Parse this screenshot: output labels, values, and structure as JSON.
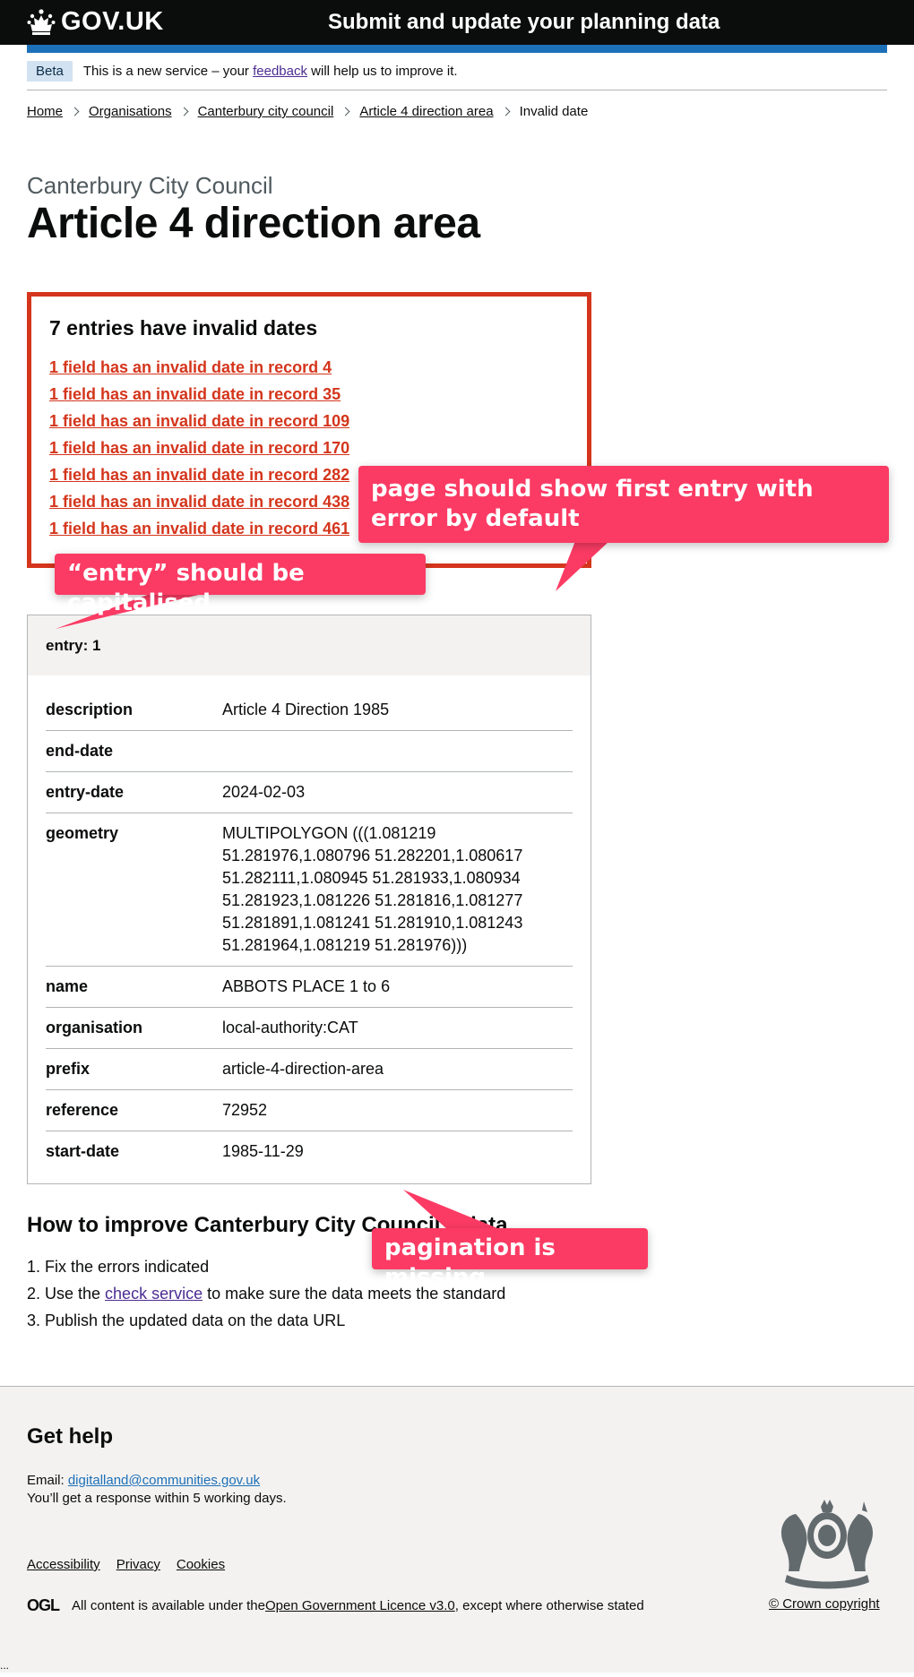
{
  "header": {
    "logo_text": "GOV.UK",
    "service_name": "Submit and update your planning data"
  },
  "phase_banner": {
    "tag": "Beta",
    "text_before": "This is a new service – your ",
    "link": "feedback",
    "text_after": " will help us to improve it."
  },
  "breadcrumbs": [
    "Home",
    "Organisations",
    "Canterbury city council",
    "Article 4 direction area",
    "Invalid date"
  ],
  "caption": "Canterbury City Council",
  "title": "Article 4 direction area",
  "error_summary": {
    "title": "7 entries have invalid dates",
    "items": [
      "1 field has an invalid date in record 4",
      "1 field has an invalid date in record 35",
      "1 field has an invalid date in record 109",
      "1 field has an invalid date in record 170",
      "1 field has an invalid date in record 282",
      "1 field has an invalid date in record 438",
      "1 field has an invalid date in record 461"
    ]
  },
  "entry_card": {
    "title": "entry: 1",
    "rows": [
      {
        "key": "description",
        "value": "Article 4 Direction 1985"
      },
      {
        "key": "end-date",
        "value": ""
      },
      {
        "key": "entry-date",
        "value": "2024-02-03"
      },
      {
        "key": "geometry",
        "value": "MULTIPOLYGON (((1.081219 51.281976,1.080796 51.282201,1.080617 51.282111,1.080945 51.281933,1.080934 51.281923,1.081226 51.281816,1.081277 51.281891,1.081241 51.281910,1.081243 51.281964,1.081219 51.281976)))"
      },
      {
        "key": "name",
        "value": "ABBOTS PLACE 1 to 6"
      },
      {
        "key": "organisation",
        "value": "local-authority:CAT"
      },
      {
        "key": "prefix",
        "value": "article-4-direction-area"
      },
      {
        "key": "reference",
        "value": "72952"
      },
      {
        "key": "start-date",
        "value": "1985-11-29"
      }
    ]
  },
  "improve": {
    "heading": "How to improve Canterbury City Council’s data",
    "step1": "1. Fix the errors indicated",
    "step2_before": "2. Use the ",
    "step2_link": "check service",
    "step2_after": " to make sure the data meets the standard",
    "step3": "3. Publish the updated data on the data URL"
  },
  "footer": {
    "help_heading": "Get help",
    "email_label": "Email: ",
    "email": "digitalland@communities.gov.uk",
    "response_text": "You’ll get a response within 5 working days.",
    "links": [
      "Accessibility",
      "Privacy",
      "Cookies"
    ],
    "ogl_logo": "OGL",
    "licence_before": "All content is available under the ",
    "licence_link": "Open Government Licence v3.0",
    "licence_after": ", except where otherwise stated",
    "crown_copyright": "© Crown copyright"
  },
  "annotations": {
    "first_entry": "page should show first entry with error by default",
    "capitalise": "“entry” should be capitalised",
    "pagination": "pagination is missing"
  },
  "colors": {
    "header_bg": "#0b0c0c",
    "brand_blue": "#1d70b8",
    "error_red": "#d4351c",
    "link_visited": "#4c2c92",
    "annotation_pink": "#fb3b64"
  },
  "trailing_text": "..."
}
